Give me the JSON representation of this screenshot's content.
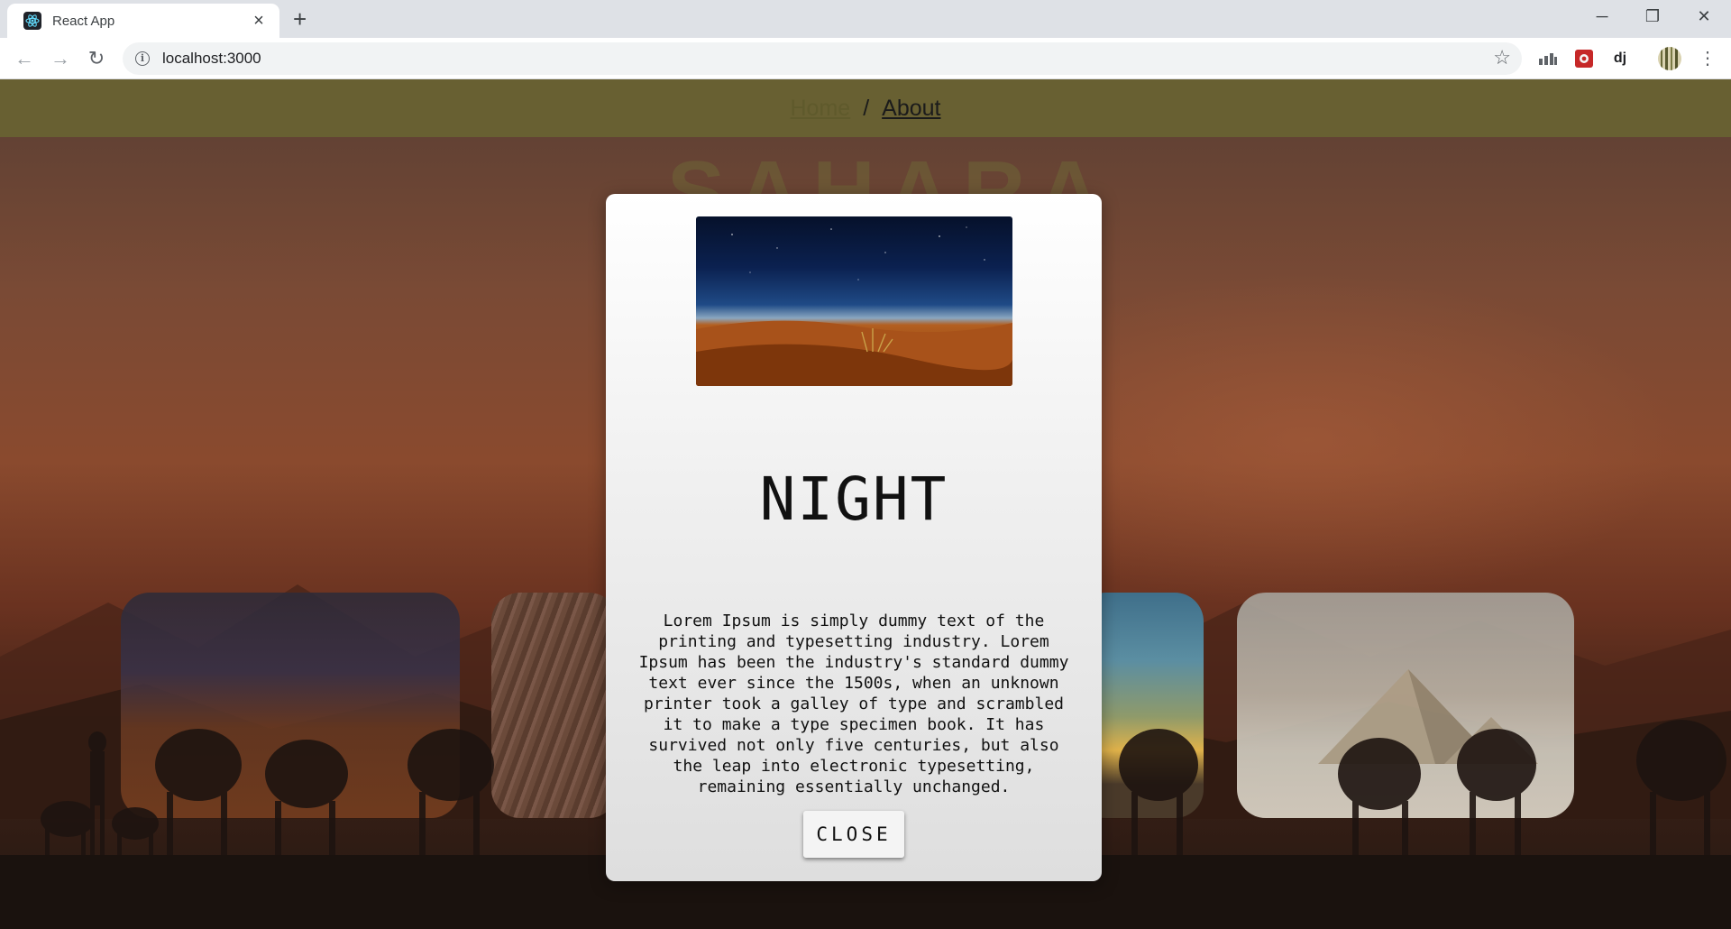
{
  "browser": {
    "tab_title": "React App",
    "tab_favicon": "react-atom-icon",
    "url": "localhost:3000",
    "window_controls": {
      "minimize": "─",
      "restore": "❐",
      "close": "✕"
    },
    "extensions": [
      "bar-chart-extension-icon",
      "red-square-extension-icon",
      "dj-extension-icon",
      "striped-avatar-icon"
    ],
    "extension_dj_label": "dj"
  },
  "navbar": {
    "home_label": "Home",
    "separator": "/",
    "about_label": "About",
    "background": "#686032"
  },
  "hero": {
    "title": "SAHARA"
  },
  "cards": [
    {
      "name": "night-card"
    },
    {
      "name": "rock-card"
    },
    {
      "name": "sky-card"
    },
    {
      "name": "pyramids-card"
    }
  ],
  "modal": {
    "image_icon": "desert-night-image",
    "title": "NIGHT",
    "body": "Lorem Ipsum is simply dummy text of the printing and typesetting industry. Lorem Ipsum has been the industry's standard dummy text ever since the 1500s, when an unknown printer took a galley of type and scrambled it to make a type specimen book. It has survived not only five centuries, but also the leap into electronic typesetting, remaining essentially unchanged.",
    "close_label": "CLOSE"
  }
}
